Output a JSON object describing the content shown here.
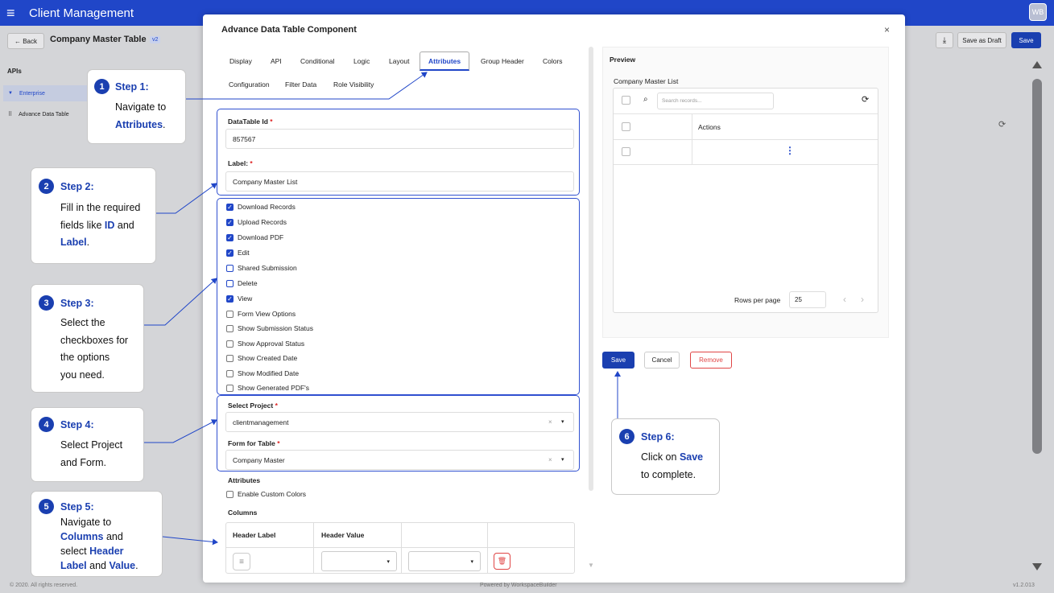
{
  "topbar": {
    "app_name": "Client Management",
    "avatar": "WB",
    "menu_icon": "hamburger-icon"
  },
  "subbar": {
    "back": "← Back",
    "title": "Company Master Table",
    "version": "v2",
    "draft": "Save as Draft",
    "save": "Save",
    "download_icon": "download-icon"
  },
  "sidebar": {
    "title": "APIs",
    "items": [
      {
        "label": "Enterprise",
        "icon": "filter-icon"
      },
      {
        "label": "Advance Data Table",
        "icon": "drag-handle-icon"
      }
    ]
  },
  "footer": {
    "copyright": "© 2020. All rights reserved.",
    "powered": "Powered by WorkspaceBuilder",
    "version": "v1.2.013"
  },
  "modal": {
    "title": "Advance Data Table Component",
    "close": "×",
    "tabs": [
      "Display",
      "API",
      "Conditional",
      "Logic",
      "Layout",
      "Attributes",
      "Group Header",
      "Colors",
      "Configuration",
      "Filter Data",
      "Role Visibility"
    ],
    "active_tab": "Attributes",
    "fields": {
      "datatable_id_label": "DataTable Id",
      "datatable_id_value": "857567",
      "label_label": "Label:",
      "label_value": "Company Master List",
      "required_mark": "*"
    },
    "checkboxes": [
      {
        "label": "Download Records",
        "checked": true
      },
      {
        "label": "Upload Records",
        "checked": true
      },
      {
        "label": "Download PDF",
        "checked": true
      },
      {
        "label": "Edit",
        "checked": true
      },
      {
        "label": "Shared Submission",
        "checked": false
      },
      {
        "label": "Delete",
        "checked": false
      },
      {
        "label": "View",
        "checked": true
      },
      {
        "label": "Form View Options",
        "checked": false
      },
      {
        "label": "Show Submission Status",
        "checked": false
      },
      {
        "label": "Show Approval Status",
        "checked": false
      },
      {
        "label": "Show Created Date",
        "checked": false
      },
      {
        "label": "Show Modified Date",
        "checked": false
      },
      {
        "label": "Show Generated PDF's",
        "checked": false
      }
    ],
    "project": {
      "label": "Select Project",
      "value": "clientmanagement",
      "clear": "×",
      "caret": "▾"
    },
    "form": {
      "label": "Form for Table",
      "value": "Company Master",
      "clear": "×",
      "caret": "▾"
    },
    "attributes": {
      "title": "Attributes",
      "custom_colors": "Enable Custom Colors"
    },
    "columns": {
      "title": "Columns",
      "header_label": "Header Label",
      "header_value": "Header Value",
      "caret": "▾"
    },
    "preview": {
      "title": "Preview",
      "table_title": "Company Master List",
      "search_placeholder": "Search records...",
      "actions": "Actions",
      "kebab": "⋮",
      "rows_per_page": "Rows per page",
      "rows_value": "25",
      "prev": "‹",
      "next": "›"
    },
    "buttons": {
      "save": "Save",
      "cancel": "Cancel",
      "remove": "Remove"
    }
  },
  "steps": [
    {
      "num": "1",
      "title": "Step 1:",
      "l1": "Navigate to",
      "l2_hl": "Attributes",
      "l2_end": "."
    },
    {
      "num": "2",
      "title": "Step 2:",
      "l1": "Fill in the required",
      "l2a": "fields like ",
      "l2_hl": "ID",
      "l2b": " and",
      "l3_hl": "Label",
      "l3_end": "."
    },
    {
      "num": "3",
      "title": "Step 3:",
      "l1": "Select the",
      "l2": "checkboxes for",
      "l3": "the options",
      "l4": "you need."
    },
    {
      "num": "4",
      "title": "Step 4:",
      "l1": "Select Project",
      "l2": "and Form."
    },
    {
      "num": "5",
      "title": "Step 5:",
      "l1": "Navigate to",
      "l2_hl": "Columns",
      "l2_end": " and",
      "l3a": "select ",
      "l3_hl": "Header",
      "l4_hl": "Label",
      "l4_mid": " and ",
      "l4_hl2": "Value",
      "l4_end": "."
    },
    {
      "num": "6",
      "title": "Step 6:",
      "l1a": "Click on ",
      "l1_hl": "Save",
      "l2": "to complete."
    }
  ],
  "colors": {
    "brand": "#2046c8",
    "step": "#1a3fb0",
    "remove": "#e04545"
  }
}
